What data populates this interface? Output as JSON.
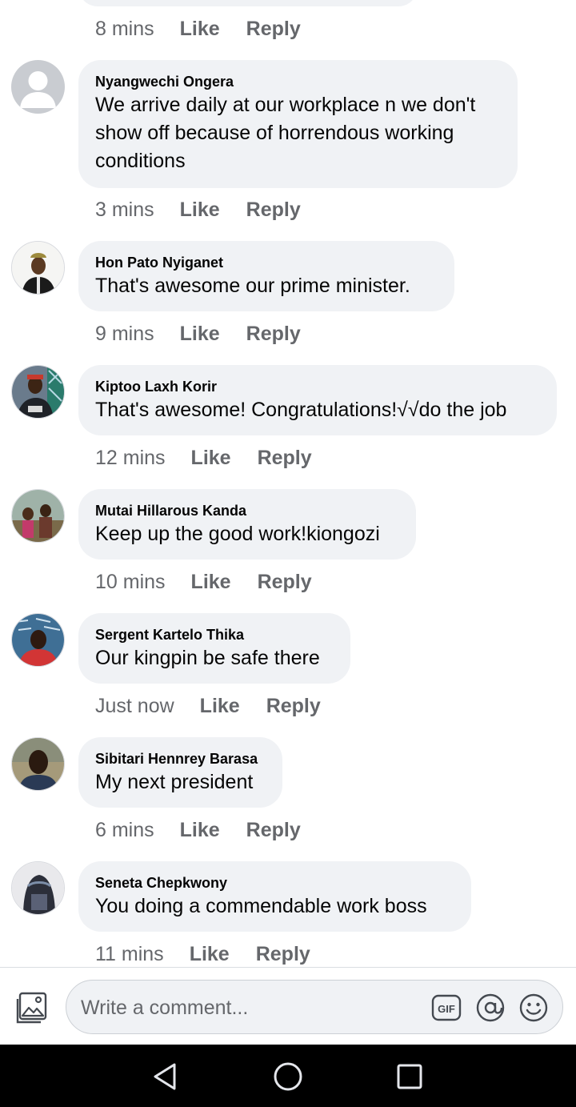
{
  "first_meta": {
    "time": "8 mins",
    "like": "Like",
    "reply": "Reply"
  },
  "comments": [
    {
      "author": "Nyangwechi Ongera",
      "lines": [
        "We arrive daily at our workplace n we don't",
        "show off because of horrendous working",
        "conditions"
      ],
      "time": "3 mins",
      "like": "Like",
      "reply": "Reply"
    },
    {
      "author": "Hon Pato Nyiganet",
      "lines": [
        "That's awesome our prime minister."
      ],
      "time": "9 mins",
      "like": "Like",
      "reply": "Reply"
    },
    {
      "author": "Kiptoo Laxh Korir",
      "lines": [
        "That's awesome! Congratulations!√√do the job"
      ],
      "time": "12 mins",
      "like": "Like",
      "reply": "Reply"
    },
    {
      "author": "Mutai Hillarous Kanda",
      "lines": [
        "Keep up the good work!kiongozi"
      ],
      "time": "10 mins",
      "like": "Like",
      "reply": "Reply"
    },
    {
      "author": "Sergent Kartelo Thika",
      "lines": [
        "Our kingpin be safe there"
      ],
      "time": "Just now",
      "like": "Like",
      "reply": "Reply"
    },
    {
      "author": "Sibitari Hennrey Barasa",
      "lines": [
        "My next president"
      ],
      "time": "6 mins",
      "like": "Like",
      "reply": "Reply"
    },
    {
      "author": "Seneta Chepkwony",
      "lines": [
        "You doing a commendable work boss"
      ],
      "time": "11 mins",
      "like": "Like",
      "reply": "Reply"
    }
  ],
  "composer": {
    "placeholder": "Write a comment...",
    "icons": [
      "photo-icon",
      "gif-icon",
      "mention-icon",
      "emoji-icon"
    ],
    "gif_label": "GIF"
  },
  "navbar": {
    "icons": [
      "back-icon",
      "home-icon",
      "recents-icon"
    ]
  },
  "colors": {
    "bubble": "#f0f2f5",
    "meta_text": "#65676b",
    "navbar": "#000000"
  }
}
